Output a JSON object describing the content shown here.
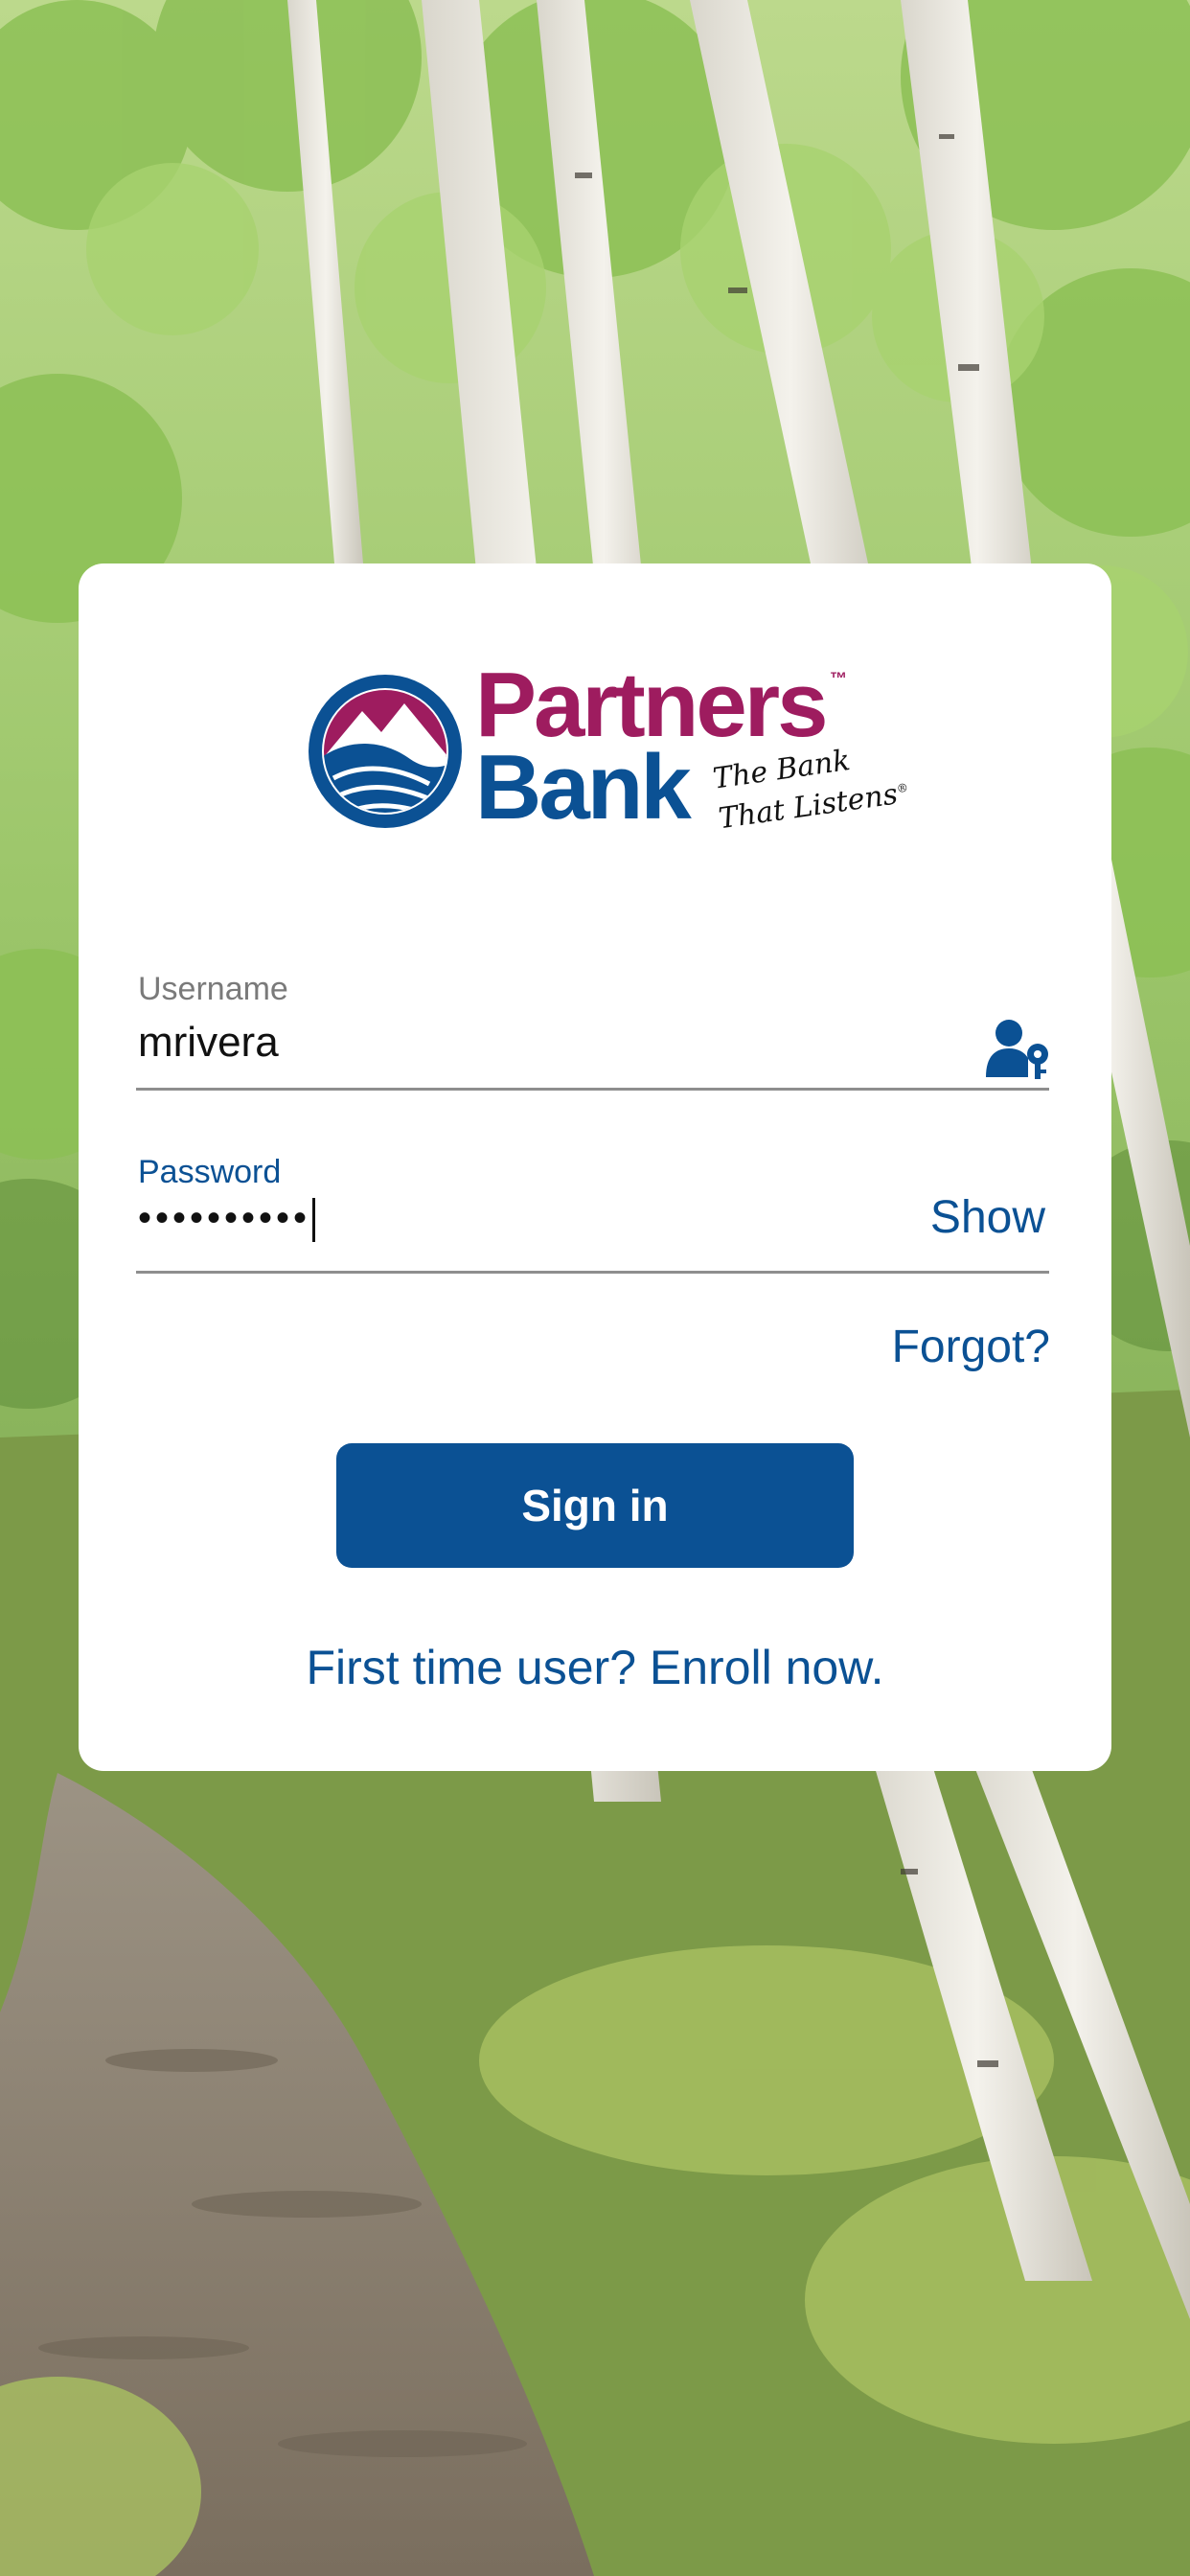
{
  "colors": {
    "brand_blue": "#0b5194",
    "brand_magenta": "#9e1c5f",
    "label_gray": "#7a7a7a",
    "card_bg": "#ffffff",
    "foliage_green": "#7fb350",
    "path_brown": "#8a7a66"
  },
  "logo": {
    "word_1": "Partners",
    "trademark": "™",
    "word_2": "Bank",
    "tagline_line_1": "The Bank",
    "tagline_line_2": "That Listens",
    "tagline_mark": "®",
    "emblem_icon": "mountain-wave-emblem-icon"
  },
  "username": {
    "label": "Username",
    "value": "mrivera",
    "icon": "user-key-icon"
  },
  "password": {
    "label": "Password",
    "masked_value": "••••••••••",
    "show_label": "Show"
  },
  "forgot_label": "Forgot?",
  "sign_in_label": "Sign in",
  "enroll_label": "First time user? Enroll now."
}
